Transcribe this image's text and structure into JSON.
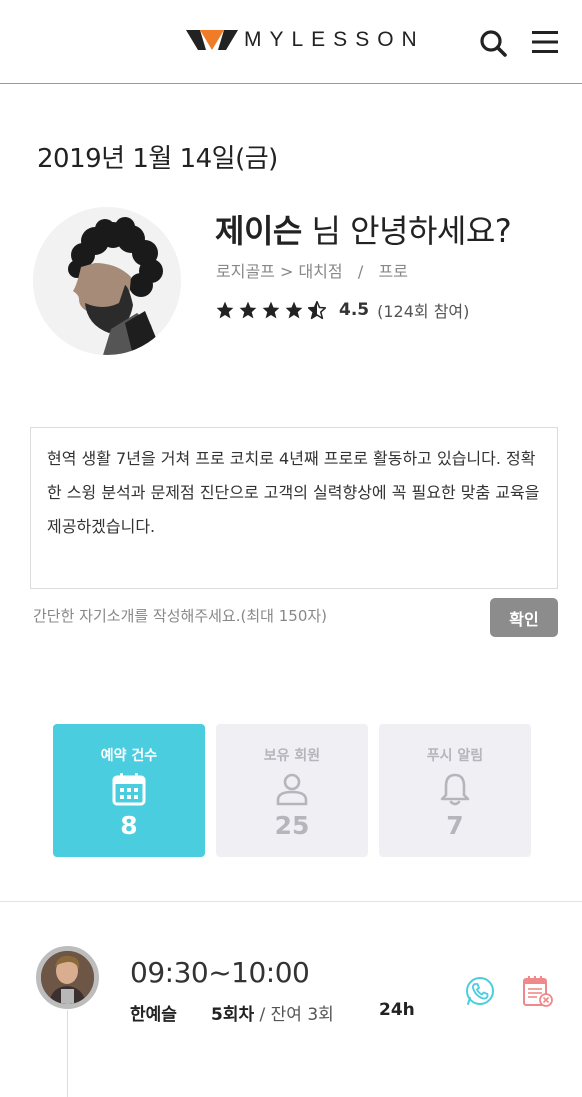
{
  "header": {
    "logo_text": "MYLESSON",
    "colors": {
      "logo_dark": "#222222",
      "logo_accent": "#f07c28"
    }
  },
  "date": "2019년 1월 14일(금)",
  "profile": {
    "name": "제이슨",
    "greeting_suffix": " 님 안녕하세요?",
    "affiliation": "로지골프 > 대치점   /   프로",
    "rating": "4.5",
    "rating_count": "(124회 참여)",
    "stars": 4.5
  },
  "intro": {
    "text": "현역 생활 7년을 거쳐 프로 코치로 4년째 프로로 활동하고 있습니다. 정확한 스윙 분석과 문제점 진단으로 고객의 실력향상에 꼭 필요한 맞춤 교육을 제공하겠습니다.",
    "hint": "간단한 자기소개를 작성해주세요.(최대 150자)",
    "confirm_label": "확인"
  },
  "stats": [
    {
      "label": "예약 건수",
      "value": "8",
      "icon": "calendar-icon",
      "active": true
    },
    {
      "label": "보유 회원",
      "value": "25",
      "icon": "person-icon",
      "active": false
    },
    {
      "label": "푸시 알림",
      "value": "7",
      "icon": "bell-icon",
      "active": false
    }
  ],
  "colors": {
    "accent": "#4bcde0",
    "confirm_bg": "#8c8c8c",
    "cancel_icon": "#f08a8a"
  },
  "schedule": [
    {
      "time": "09:30~10:00",
      "student": "한예슬",
      "session": "5회차",
      "remaining": " / 잔여 3회",
      "duration": "24h"
    }
  ]
}
